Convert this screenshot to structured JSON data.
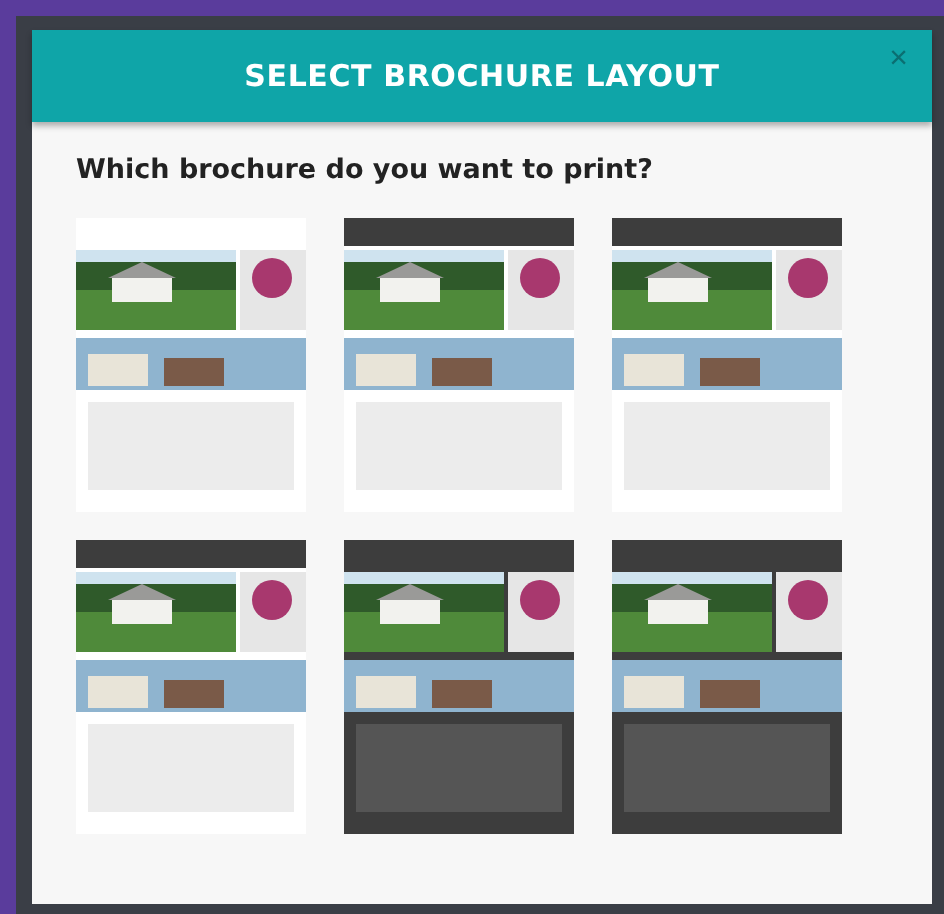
{
  "dialog": {
    "title": "SELECT BROCHURE LAYOUT",
    "close": "×",
    "question": "Which brochure do you want to print?"
  }
}
